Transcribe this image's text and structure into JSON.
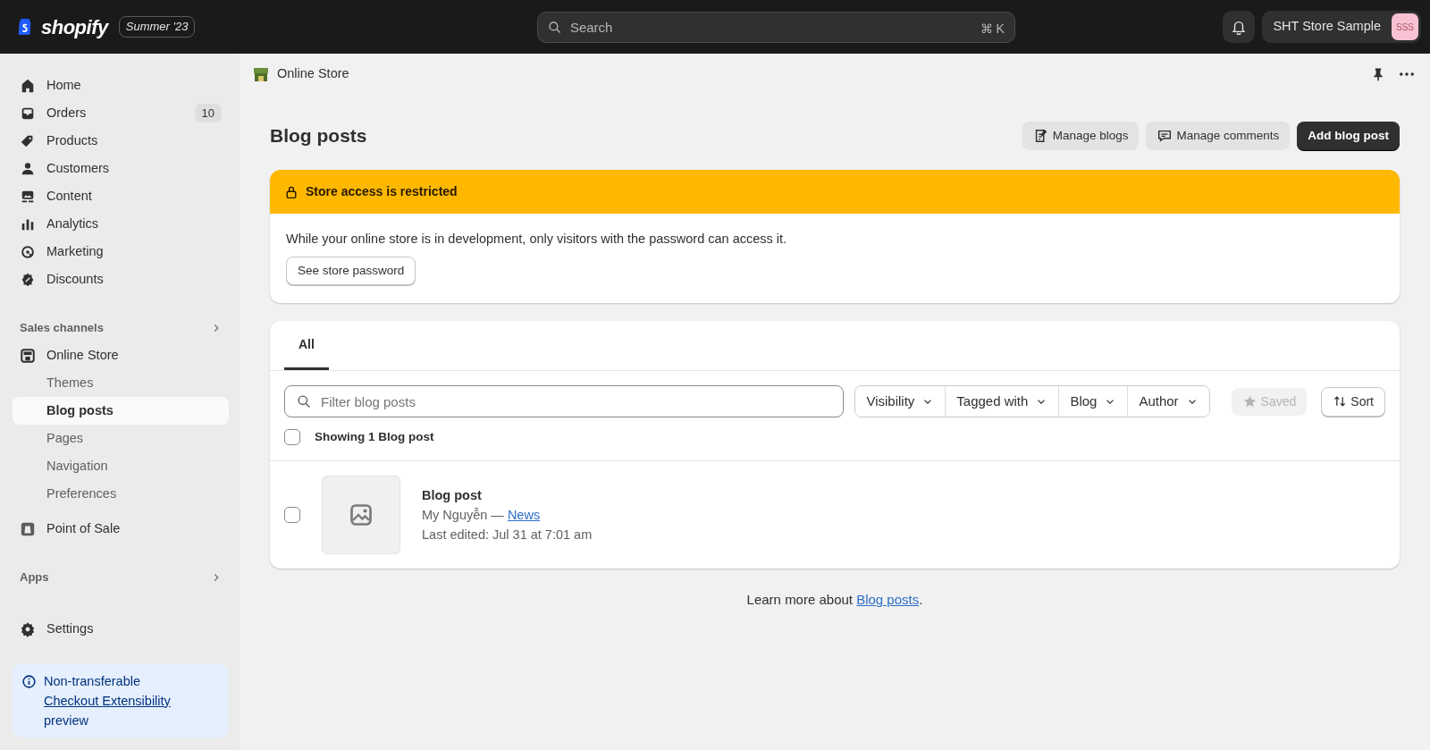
{
  "topbar": {
    "logo": "shopify",
    "edition": "Summer '23",
    "search": {
      "placeholder": "Search",
      "shortcut": "⌘ K"
    },
    "store": {
      "name": "SHT Store Sample",
      "initials": "SSS"
    }
  },
  "sidebar": {
    "items": [
      {
        "label": "Home",
        "selected": false
      },
      {
        "label": "Orders",
        "badge": "10",
        "selected": false
      },
      {
        "label": "Products",
        "selected": false
      },
      {
        "label": "Customers",
        "selected": false
      },
      {
        "label": "Content",
        "selected": false
      },
      {
        "label": "Analytics",
        "selected": false
      },
      {
        "label": "Marketing",
        "selected": false
      },
      {
        "label": "Discounts",
        "selected": false
      }
    ],
    "sales_channels": {
      "heading": "Sales channels",
      "items": [
        {
          "label": "Online Store",
          "selected": false,
          "children": [
            {
              "label": "Themes",
              "selected": false
            },
            {
              "label": "Blog posts",
              "selected": true
            },
            {
              "label": "Pages",
              "selected": false
            },
            {
              "label": "Navigation",
              "selected": false
            },
            {
              "label": "Preferences",
              "selected": false
            }
          ]
        },
        {
          "label": "Point of Sale",
          "selected": false
        }
      ]
    },
    "apps": {
      "heading": "Apps"
    },
    "settings": {
      "label": "Settings"
    },
    "notice": {
      "text": "Non-transferable",
      "link": "Checkout Extensibility",
      "after": "preview"
    }
  },
  "breadcrumb": "Online Store",
  "page": {
    "title": "Blog posts",
    "actions": [
      {
        "label": "Manage blogs",
        "kind": "secondary"
      },
      {
        "label": "Manage comments",
        "kind": "secondary"
      },
      {
        "label": "Add blog post",
        "kind": "primary"
      }
    ]
  },
  "banner": {
    "title": "Store access is restricted",
    "text": "While your online store is in development, only visitors with the password can access it.",
    "button": "See store password"
  },
  "tabs": [
    {
      "label": "All",
      "selected": true
    }
  ],
  "filter": {
    "placeholder": "Filter blog posts",
    "filters": [
      "Visibility",
      "Tagged with",
      "Blog",
      "Author"
    ],
    "saved": {
      "label": "Saved",
      "disabled": true
    },
    "sort": "Sort"
  },
  "select_all": {
    "label": "Showing 1 Blog post",
    "checked": false
  },
  "rows": [
    {
      "title": "Blog post",
      "author": "My Nguyễn —",
      "blog": "News",
      "edited": "Last edited: Jul 31 at 7:01 am",
      "checked": false
    }
  ],
  "footer": {
    "text": "Learn more about",
    "link": "Blog posts",
    "end": "."
  }
}
